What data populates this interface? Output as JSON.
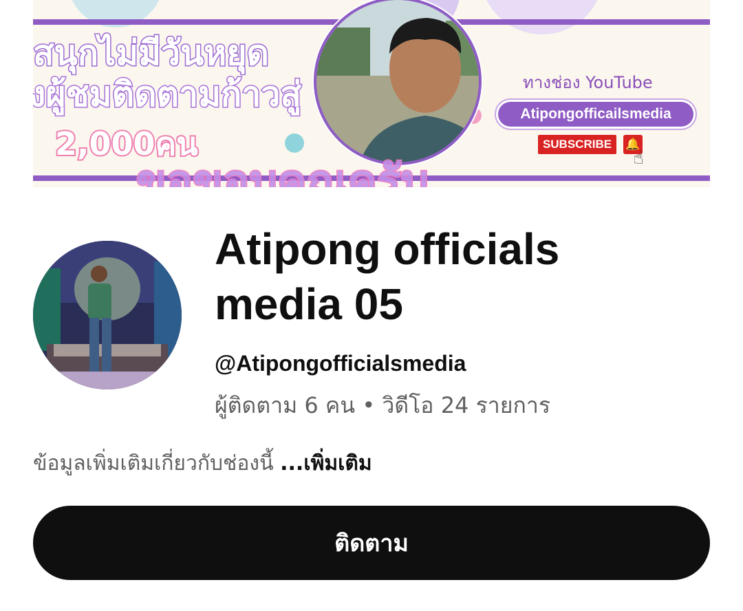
{
  "banner": {
    "line1": "สนุกไม่มีวันหยุด",
    "line2": "งผู้ชมติดตามก้าวสู่",
    "line3": "2,000คน",
    "bottom_text": "ขอขอบคุณครับ",
    "via_text": "ทางช่อง YouTube",
    "channel_pill": "Atipongofficailsmedia",
    "subscribe_label": "SUBSCRIBE",
    "colors": {
      "purple": "#8e5cc4",
      "pink": "#ee7fb0",
      "red": "#d92222"
    }
  },
  "channel": {
    "title": "Atipong officials media 05",
    "handle": "@Atipongofficialsmedia",
    "stats": "ผู้ติดตาม 6 คน • วิดีโอ 24 รายการ"
  },
  "about": {
    "text": "ข้อมูลเพิ่มเติมเกี่ยวกับช่องนี้ ",
    "more_label": "...เพิ่มเติม"
  },
  "subscribe_button": {
    "label": "ติดตาม"
  },
  "icons": {
    "bell": "bell-icon",
    "cursor_hand": "hand-pointer-icon"
  }
}
